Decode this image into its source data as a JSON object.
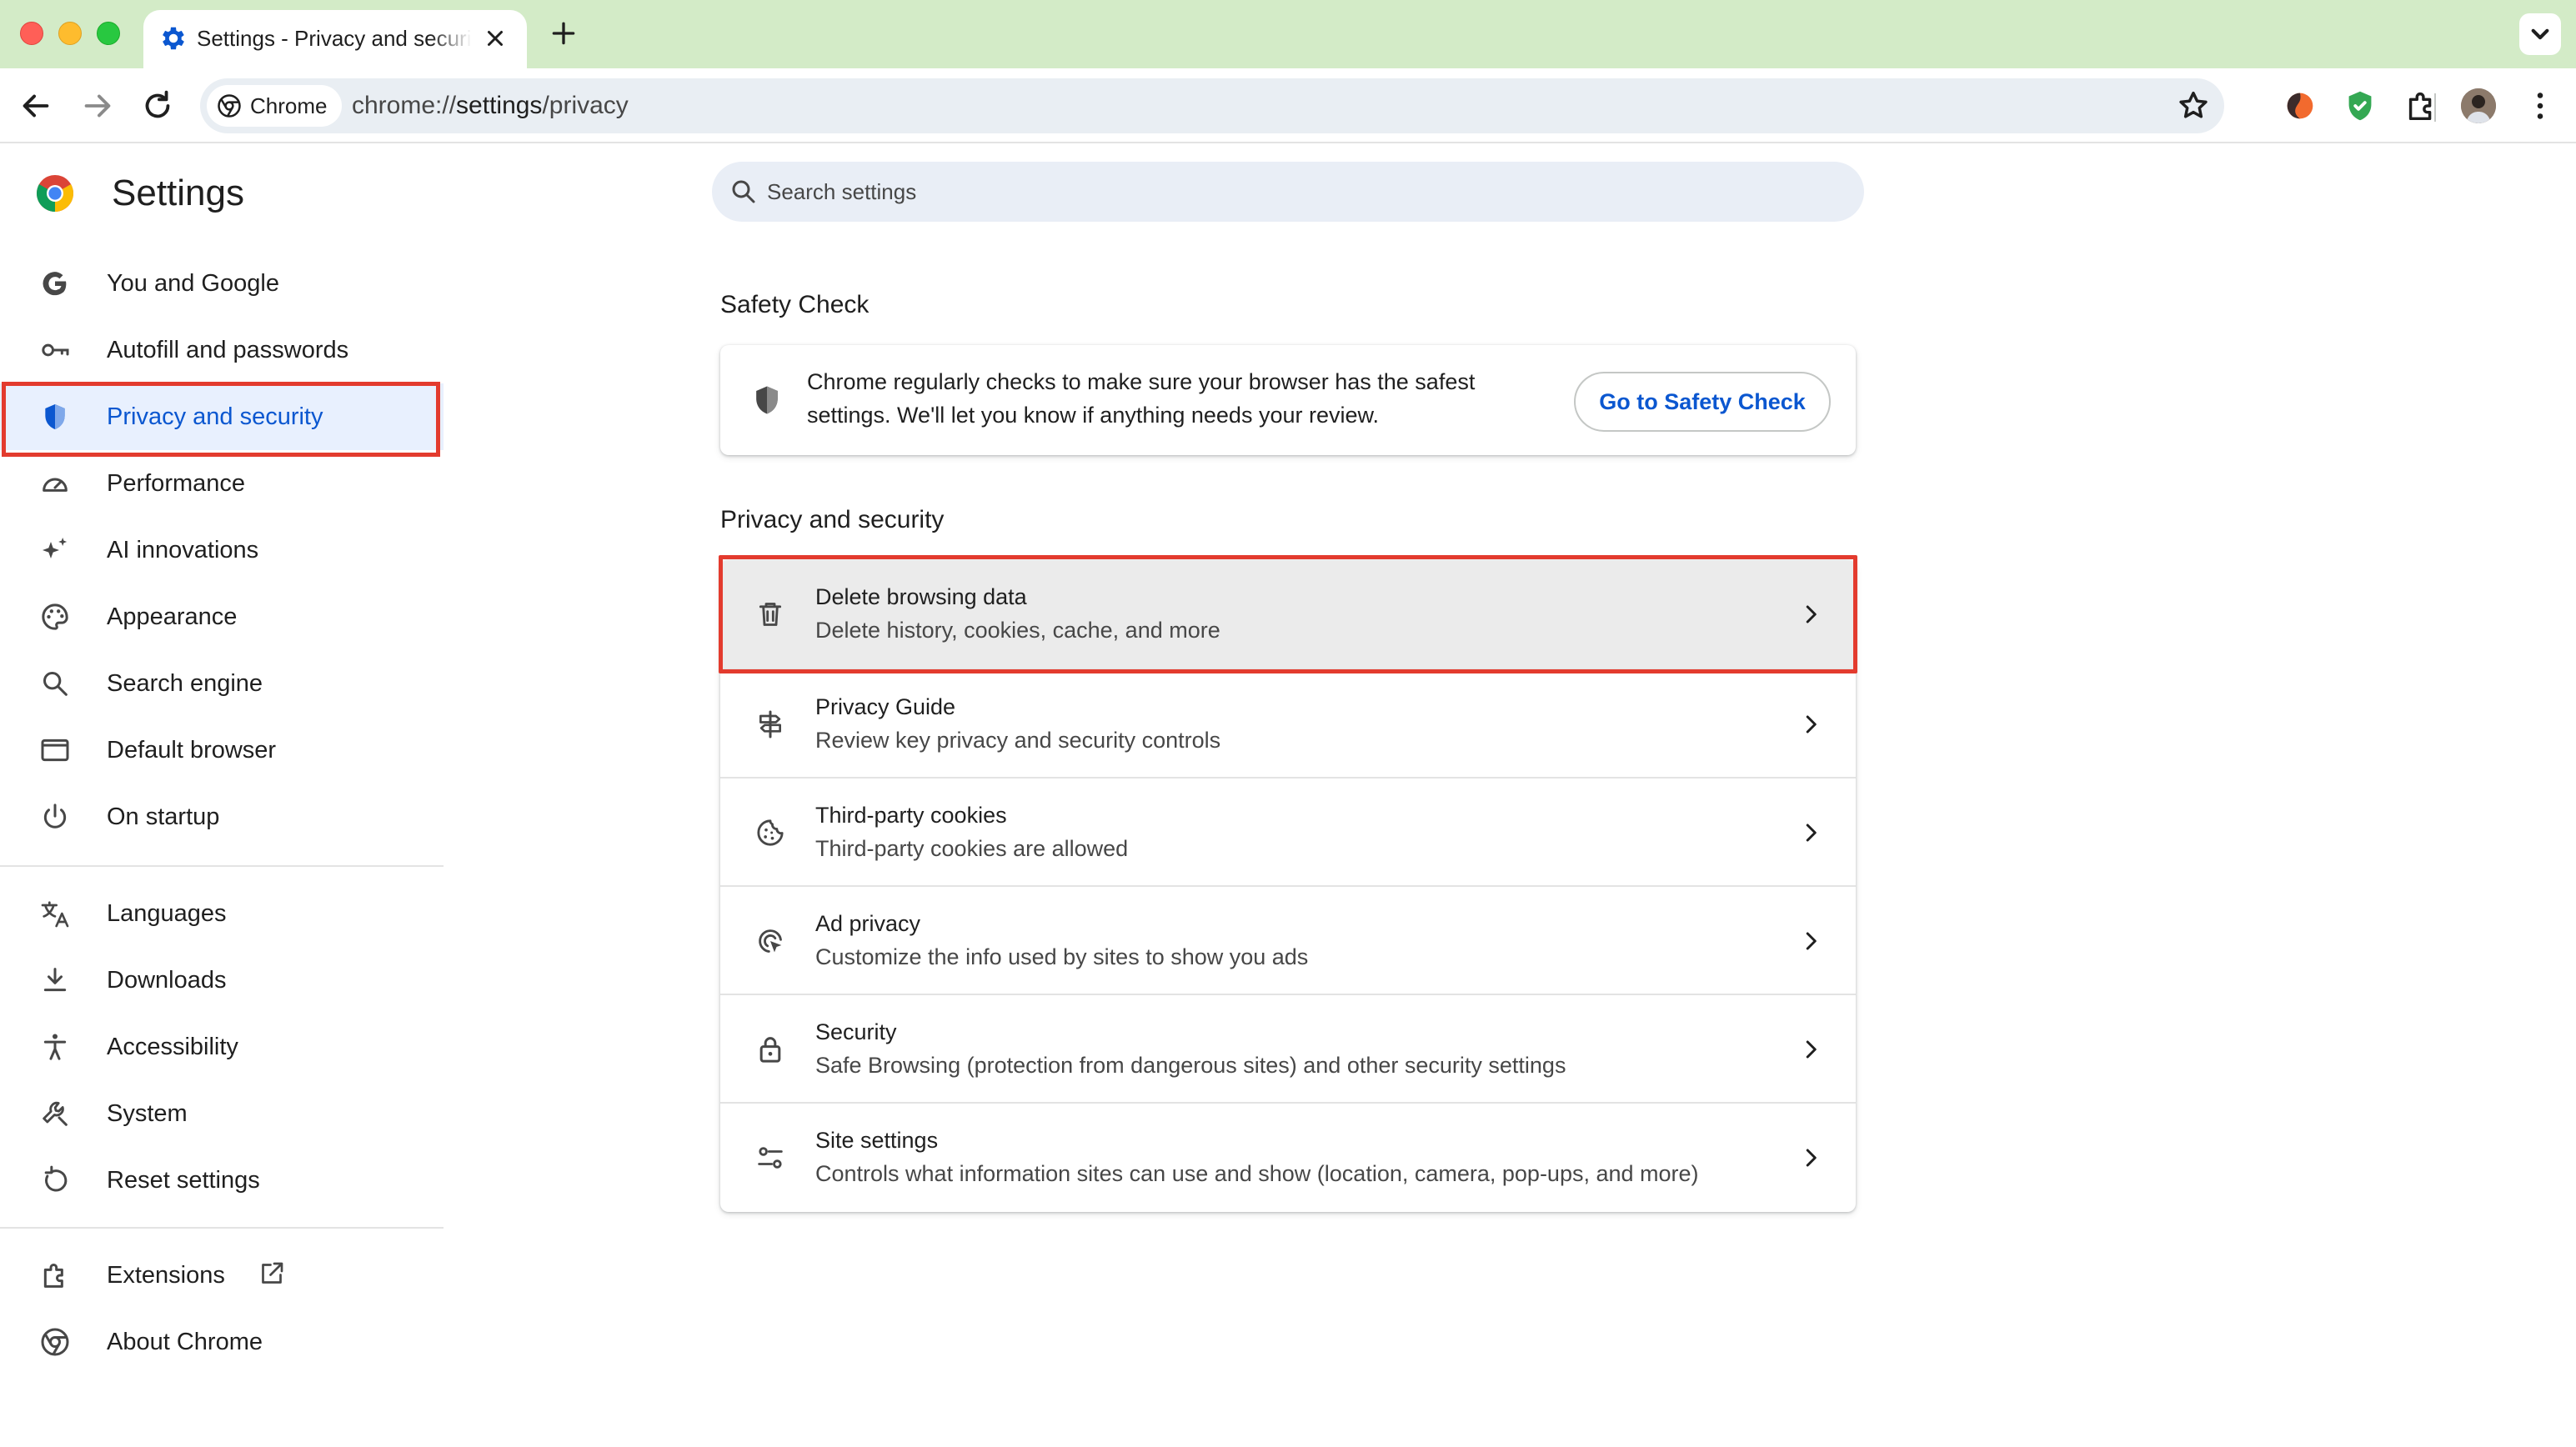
{
  "window": {
    "traffic_lights": [
      "close",
      "minimize",
      "zoom"
    ]
  },
  "tab": {
    "title": "Settings - Privacy and security",
    "favicon": "gear-icon"
  },
  "toolbar": {
    "chip_label": "Chrome",
    "url_scheme": "chrome://",
    "url_host": "settings",
    "url_path": "/privacy"
  },
  "sidebar": {
    "title": "Settings",
    "items": [
      {
        "label": "You and Google",
        "icon": "google-g-icon"
      },
      {
        "label": "Autofill and passwords",
        "icon": "key-icon"
      },
      {
        "label": "Privacy and security",
        "icon": "shield-icon",
        "active": true
      },
      {
        "label": "Performance",
        "icon": "speedometer-icon"
      },
      {
        "label": "AI innovations",
        "icon": "sparkle-icon"
      },
      {
        "label": "Appearance",
        "icon": "palette-icon"
      },
      {
        "label": "Search engine",
        "icon": "search-icon"
      },
      {
        "label": "Default browser",
        "icon": "browser-window-icon"
      },
      {
        "label": "On startup",
        "icon": "power-icon"
      },
      {
        "label": "Languages",
        "icon": "translate-icon"
      },
      {
        "label": "Downloads",
        "icon": "download-icon"
      },
      {
        "label": "Accessibility",
        "icon": "accessibility-icon"
      },
      {
        "label": "System",
        "icon": "wrench-icon"
      },
      {
        "label": "Reset settings",
        "icon": "reset-icon"
      },
      {
        "label": "Extensions",
        "icon": "puzzle-icon"
      },
      {
        "label": "About Chrome",
        "icon": "chrome-icon"
      }
    ]
  },
  "search": {
    "placeholder": "Search settings"
  },
  "safety_check": {
    "heading": "Safety Check",
    "text": "Chrome regularly checks to make sure your browser has the safest settings. We'll let you know if anything needs your review.",
    "button": "Go to Safety Check"
  },
  "privacy": {
    "heading": "Privacy and security",
    "rows": [
      {
        "title": "Delete browsing data",
        "subtitle": "Delete history, cookies, cache, and more",
        "icon": "trash-icon"
      },
      {
        "title": "Privacy Guide",
        "subtitle": "Review key privacy and security controls",
        "icon": "signpost-icon"
      },
      {
        "title": "Third-party cookies",
        "subtitle": "Third-party cookies are allowed",
        "icon": "cookie-icon"
      },
      {
        "title": "Ad privacy",
        "subtitle": "Customize the info used by sites to show you ads",
        "icon": "ad-privacy-icon"
      },
      {
        "title": "Security",
        "subtitle": "Safe Browsing (protection from dangerous sites) and other security settings",
        "icon": "lock-icon"
      },
      {
        "title": "Site settings",
        "subtitle": "Controls what information sites can use and show (location, camera, pop-ups, and more)",
        "icon": "tune-icon"
      }
    ]
  },
  "colors": {
    "accent": "#0b57d0",
    "highlight": "#e33b2e",
    "tabstrip": "#d3ebc7",
    "active_nav_bg": "#e8f0fe"
  }
}
